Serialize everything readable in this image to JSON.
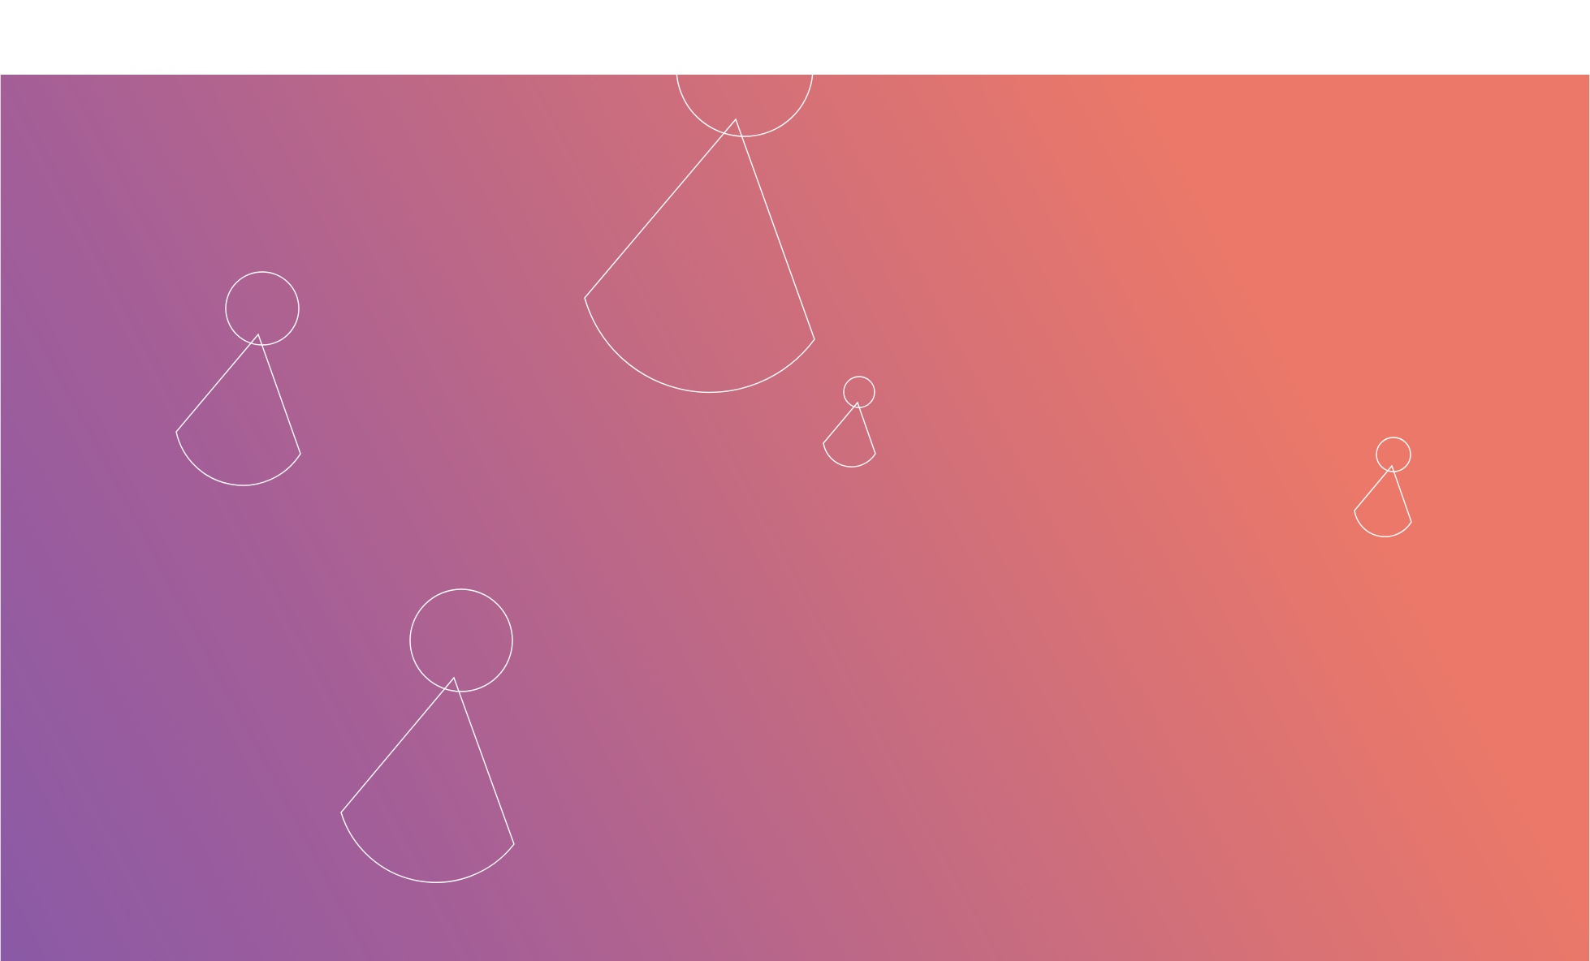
{
  "page": {
    "background": "#ffffff"
  },
  "hero": {
    "gradient": {
      "from": "#8a5aa6",
      "mid": "#c76c80",
      "to": "#eb7869"
    },
    "figure_stroke": "#ffffff",
    "figures": [
      {
        "name": "person-icon-top-center"
      },
      {
        "name": "person-icon-left"
      },
      {
        "name": "person-icon-small-center"
      },
      {
        "name": "person-icon-small-right"
      },
      {
        "name": "person-icon-bottom-left"
      }
    ]
  }
}
